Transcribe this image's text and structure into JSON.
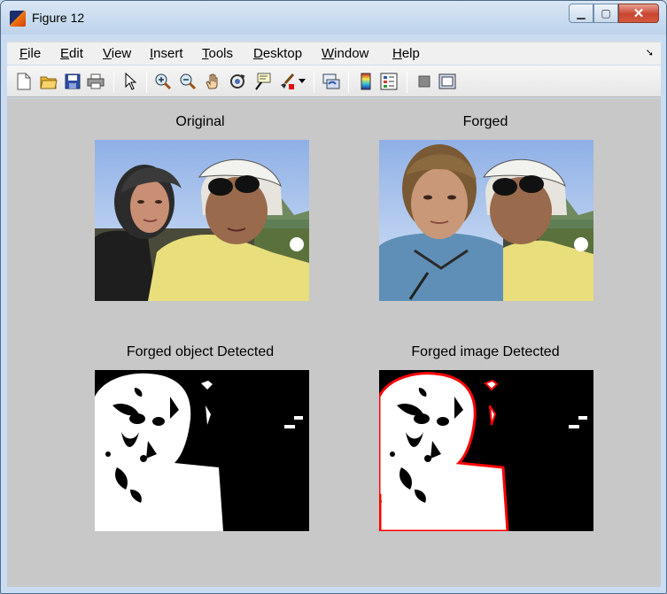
{
  "window": {
    "title": "Figure 12"
  },
  "menu": [
    "File",
    "Edit",
    "View",
    "Insert",
    "Tools",
    "Desktop",
    "Window",
    "Help"
  ],
  "menu_mnemonics": [
    "F",
    "E",
    "V",
    "I",
    "T",
    "D",
    "W",
    "H"
  ],
  "toolbar": [
    "new-figure-icon",
    "open-file-icon",
    "save-icon",
    "print-icon",
    "edit-plot-arrow-icon",
    "zoom-in-icon",
    "zoom-out-icon",
    "pan-hand-icon",
    "rotate-3d-icon",
    "data-cursor-icon",
    "brush-icon",
    "link-plot-icon",
    "colorbar-icon",
    "legend-icon",
    "hide-plot-tools-icon",
    "show-plot-tools-icon"
  ],
  "figure": {
    "panels": [
      {
        "title": "Original"
      },
      {
        "title": "Forged"
      },
      {
        "title": "Forged object  Detected"
      },
      {
        "title": "Forged image Detected"
      }
    ]
  },
  "colors": {
    "canvas": "#c8c8c8",
    "outline": "#ff0000",
    "mask_white": "#ffffff",
    "mask_black": "#000000"
  }
}
